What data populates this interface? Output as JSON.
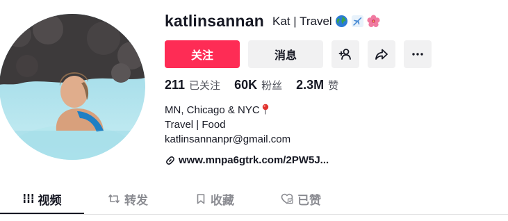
{
  "profile": {
    "username": "katlinsannan",
    "nickname": "Kat | Travel",
    "nickname_emojis": [
      "globe-icon",
      "airplane-icon",
      "hibiscus-icon"
    ]
  },
  "buttons": {
    "follow": "关注",
    "message": "消息",
    "add_friend_icon": "add-friend-icon",
    "share_icon": "share-icon",
    "more_icon": "more-icon"
  },
  "stats": {
    "following_count": "211",
    "following_label": "已关注",
    "followers_count": "60K",
    "followers_label": "粉丝",
    "likes_count": "2.3M",
    "likes_label": "赞"
  },
  "bio": {
    "line1": "MN, Chicago & NYC",
    "line2": "Travel | Food",
    "line3": "katlinsannanpr@gmail.com"
  },
  "link": {
    "text": "www.mnpa6gtrk.com/2PW5J..."
  },
  "tabs": [
    {
      "label": "视频",
      "icon": "grid-icon",
      "active": true
    },
    {
      "label": "转发",
      "icon": "repost-icon",
      "active": false
    },
    {
      "label": "收藏",
      "icon": "bookmark-icon",
      "active": false
    },
    {
      "label": "已赞",
      "icon": "liked-heart-icon",
      "active": false
    }
  ],
  "colors": {
    "accent": "#fe2c55",
    "text": "#161823",
    "secondary_text": "#50525b",
    "button_bg": "#f1f1f2"
  }
}
